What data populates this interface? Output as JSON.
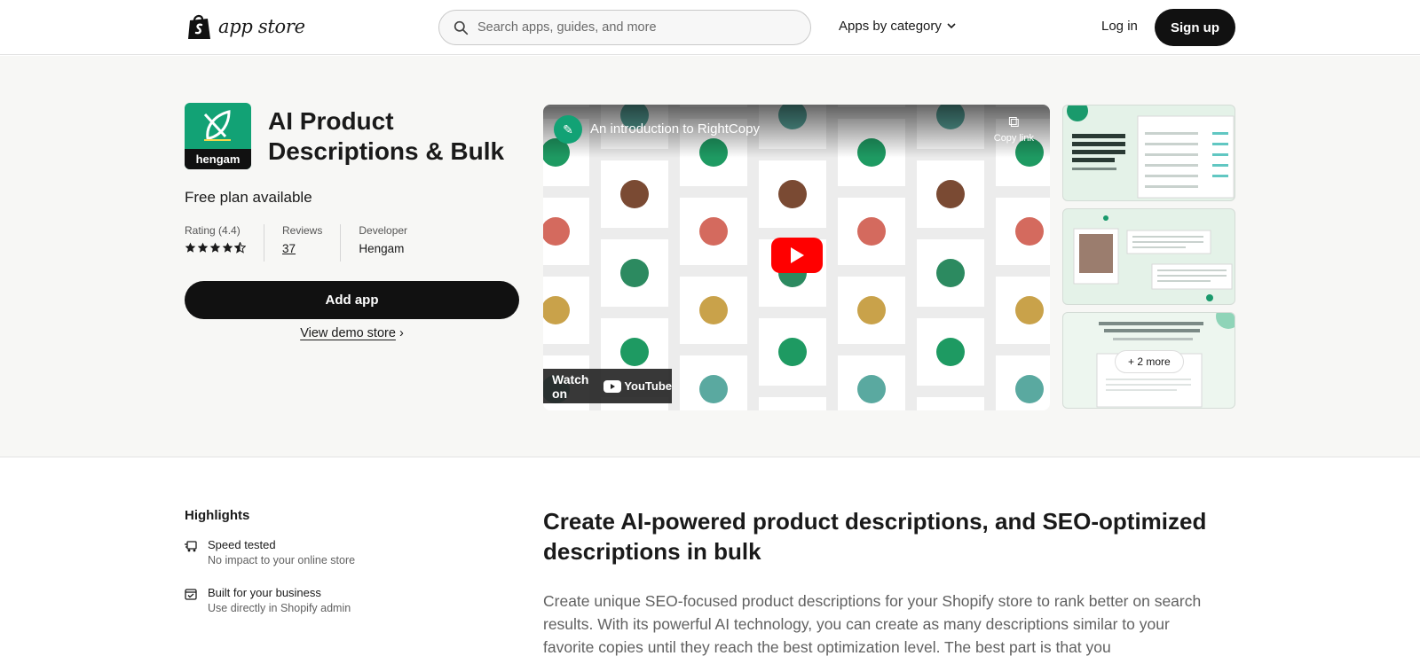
{
  "header": {
    "logo_text": "app store",
    "search_placeholder": "Search apps, guides, and more",
    "category_label": "Apps by category",
    "login_label": "Log in",
    "signup_label": "Sign up"
  },
  "app": {
    "icon_brand": "hengam",
    "title": "AI Product Descriptions & Bulk",
    "plan": "Free plan available",
    "rating_label": "Rating (4.4)",
    "rating_value": 4.4,
    "reviews_label": "Reviews",
    "reviews_count": "37",
    "developer_label": "Developer",
    "developer_name": "Hengam",
    "add_label": "Add app",
    "demo_label": "View demo store",
    "demo_chevron": "›",
    "brand_color": "#12a275"
  },
  "video": {
    "title": "An introduction to RightCopy",
    "copy_label": "Copy link",
    "watch_label": "Watch on",
    "youtube_label": "YouTube"
  },
  "thumbnails": {
    "more_label": "+ 2 more"
  },
  "highlights": {
    "title": "Highlights",
    "items": [
      {
        "title": "Speed tested",
        "subtitle": "No impact to your online store"
      },
      {
        "title": "Built for your business",
        "subtitle": "Use directly in Shopify admin"
      }
    ]
  },
  "content": {
    "headline": "Create AI-powered product descriptions, and SEO-optimized descriptions in bulk",
    "description": "Create unique SEO-focused product descriptions for your Shopify store to rank better on search results. With its powerful AI technology, you can create as many descriptions similar to your favorite copies until they reach the best optimization level. The best part is that you"
  }
}
